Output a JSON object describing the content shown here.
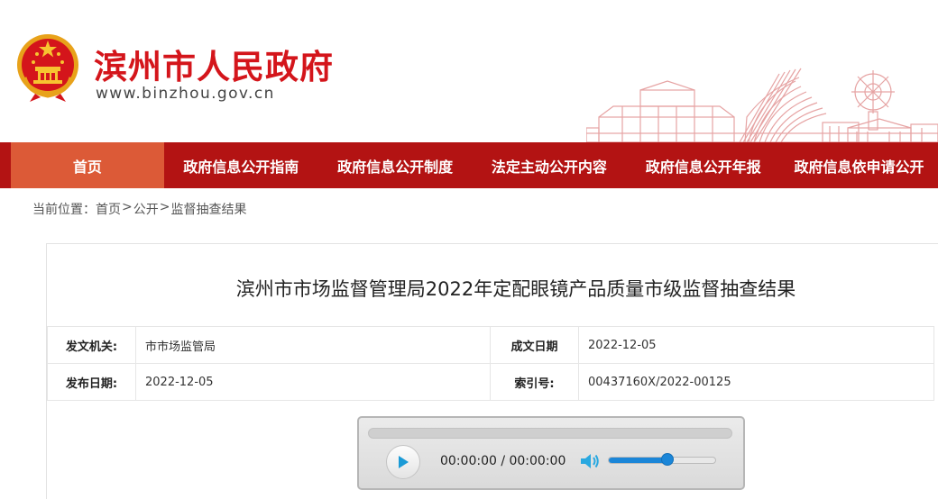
{
  "header": {
    "site_title": "滨州市人民政府",
    "site_url": "www.binzhou.gov.cn",
    "emblem_icon": "national-emblem-icon",
    "brand_color": "#d4151b"
  },
  "nav": {
    "items": [
      {
        "label": "首页",
        "active": true
      },
      {
        "label": "政府信息公开指南"
      },
      {
        "label": "政府信息公开制度"
      },
      {
        "label": "法定主动公开内容"
      },
      {
        "label": "政府信息公开年报"
      },
      {
        "label": "政府信息依申请公开"
      }
    ],
    "bg_color": "#b31313",
    "active_color": "#dc5a37"
  },
  "breadcrumb": {
    "prefix": "当前位置：",
    "items": [
      "首页",
      "公开",
      "监督抽查结果"
    ],
    "separator": ">"
  },
  "document": {
    "title": "滨州市市场监督管理局2022年定配眼镜产品质量市级监督抽查结果",
    "meta": {
      "issuer_label": "发文机关:",
      "issuer": "市市场监管局",
      "date_label": "成文日期",
      "date": "2022-12-05",
      "publish_label": "发布日期:",
      "publish_date": "2022-12-05",
      "index_label": "索引号:",
      "index_no": "00437160X/2022-00125"
    }
  },
  "player": {
    "time": "00:00:00 / 00:00:00",
    "volume": 0.55,
    "play_icon": "play-icon",
    "volume_icon": "speaker-icon"
  }
}
